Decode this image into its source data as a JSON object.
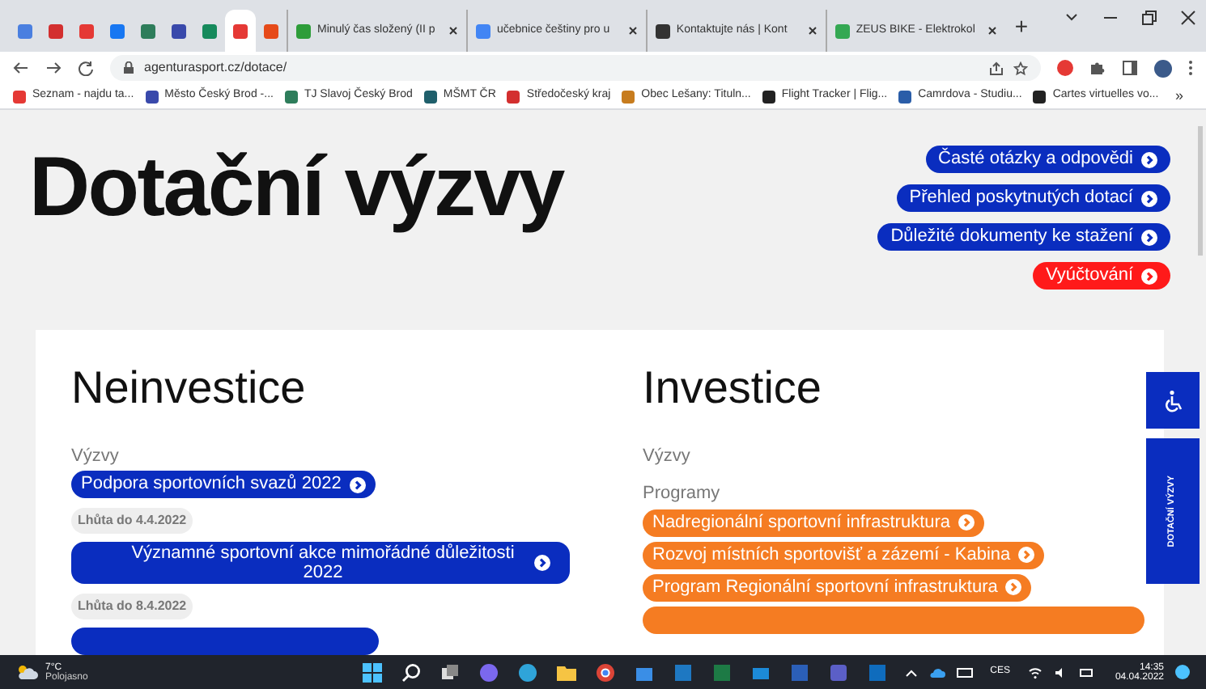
{
  "browser": {
    "tabs": [
      {
        "selected": false,
        "color": "#4a7fe0"
      },
      {
        "selected": false,
        "color": "#d32f2f"
      },
      {
        "selected": false,
        "color": "#e53935"
      },
      {
        "selected": false,
        "color": "#1877f2"
      },
      {
        "selected": false,
        "color": "#2e7d5b"
      },
      {
        "selected": false,
        "color": "#3949ab"
      },
      {
        "selected": false,
        "color": "#168a5c"
      },
      {
        "selected": true,
        "color": "#e53935"
      },
      {
        "selected": false,
        "color": "#e64a19"
      },
      {
        "title": "Minulý čas složený (II p",
        "selected": false,
        "color": "#2e9d3a"
      },
      {
        "title": "učebnice češtiny pro u",
        "selected": false,
        "color": "#4285f4"
      },
      {
        "title": "Kontaktujte nás | Kont",
        "selected": false,
        "color": "#333333"
      },
      {
        "title": "ZEUS BIKE - Elektrokol",
        "selected": false,
        "color": "#34a853"
      }
    ],
    "new_tab": "+",
    "address": "agenturasport.cz/dotace/",
    "bookmarks": [
      {
        "label": "Seznam - najdu ta...",
        "color": "#e53935"
      },
      {
        "label": "Město Český Brod -...",
        "color": "#3949ab"
      },
      {
        "label": "TJ Slavoj Český Brod",
        "color": "#2e7d5b"
      },
      {
        "label": "MŠMT ČR",
        "color": "#1f5f6b"
      },
      {
        "label": "Středočeský kraj",
        "color": "#d32f2f"
      },
      {
        "label": "Obec Lešany: Tituln...",
        "color": "#c77c1e"
      },
      {
        "label": "Flight Tracker | Flig...",
        "color": "#222222"
      },
      {
        "label": "Camrdova - Studiu...",
        "color": "#2a5da8"
      },
      {
        "label": "Cartes virtuelles vo...",
        "color": "#222222"
      }
    ],
    "bookmarks_more": "»"
  },
  "page": {
    "title": "Dotační výzvy",
    "links": [
      {
        "label": "Časté otázky a odpovědi",
        "kind": "primary"
      },
      {
        "label": "Přehled poskytnutých dotací",
        "kind": "primary"
      },
      {
        "label": "Důležité dokumenty ke stažení",
        "kind": "primary"
      },
      {
        "label": "Vyúčtování",
        "kind": "alert"
      }
    ],
    "sections": [
      {
        "heading": "Neinvestice",
        "kind": "blue",
        "groups": [
          {
            "label": "Výzvy",
            "more_below": true,
            "items": [
              {
                "label": "Podpora sportovních svazů 2022",
                "deadline": "Lhůta do 4.4.2022"
              },
              {
                "label": "Významné sportovní akce mimořádné důležitosti 2022",
                "deadline": "Lhůta do 8.4.2022"
              }
            ]
          }
        ]
      },
      {
        "heading": "Investice",
        "kind": "orange",
        "groups": [
          {
            "label": "Výzvy",
            "more_below": false
          },
          {
            "label": "Programy",
            "more_below": true,
            "items": [
              {
                "label": "Nadregionální sportovní infrastruktura"
              },
              {
                "label": "Rozvoj místních sportovišť a zázemí - Kabina"
              },
              {
                "label": "Program Regionální sportovní infrastruktura"
              }
            ]
          }
        ]
      }
    ],
    "side_tab": "DOTAČNÍ VÝZVY"
  },
  "taskbar": {
    "temperature": "7°C",
    "weather": "Polojasno",
    "language": "CES",
    "time": "14:35",
    "date": "04.04.2022"
  }
}
